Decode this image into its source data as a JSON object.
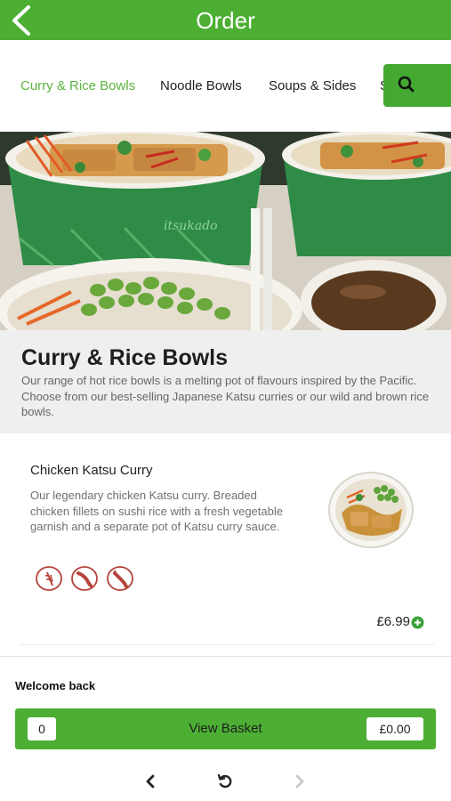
{
  "header": {
    "title": "Order",
    "back_icon": "chevron-left-icon"
  },
  "tabs": [
    {
      "label": "Curry & Rice Bowls",
      "active": true
    },
    {
      "label": "Noodle Bowls",
      "active": false
    },
    {
      "label": "Soups & Sides",
      "active": false
    },
    {
      "label": "S",
      "active": false
    }
  ],
  "search": {
    "icon": "search-icon"
  },
  "category": {
    "title": "Curry & Rice Bowls",
    "description": "Our range of hot rice bowls is a melting pot of flavours inspired by the Pacific. Choose from our best-selling Japanese Katsu curries or our wild and brown rice bowls."
  },
  "hero_image": {
    "brand_text": "itsukado"
  },
  "item": {
    "name": "Chicken Katsu Curry",
    "description": "Our legendary chicken Katsu curry. Breaded chicken fillets on sushi rice with a fresh vegetable garnish and a separate pot of Katsu curry sauce.",
    "allergen_icons": [
      "wheat-icon",
      "crustacean-icon",
      "chilli-icon"
    ],
    "price": "£6.99",
    "add_icon": "plus-circle-icon"
  },
  "footer": {
    "welcome": "Welcome back",
    "basket_count": "0",
    "basket_label": "View Basket",
    "basket_total": "£0.00"
  },
  "browser_nav": {
    "back_icon": "chevron-left-icon",
    "reload_icon": "reload-icon",
    "forward_icon": "chevron-right-icon"
  },
  "colors": {
    "brand_green": "#4caf33",
    "active_tab": "#5cb33f",
    "allergen_red": "#b5433a"
  }
}
